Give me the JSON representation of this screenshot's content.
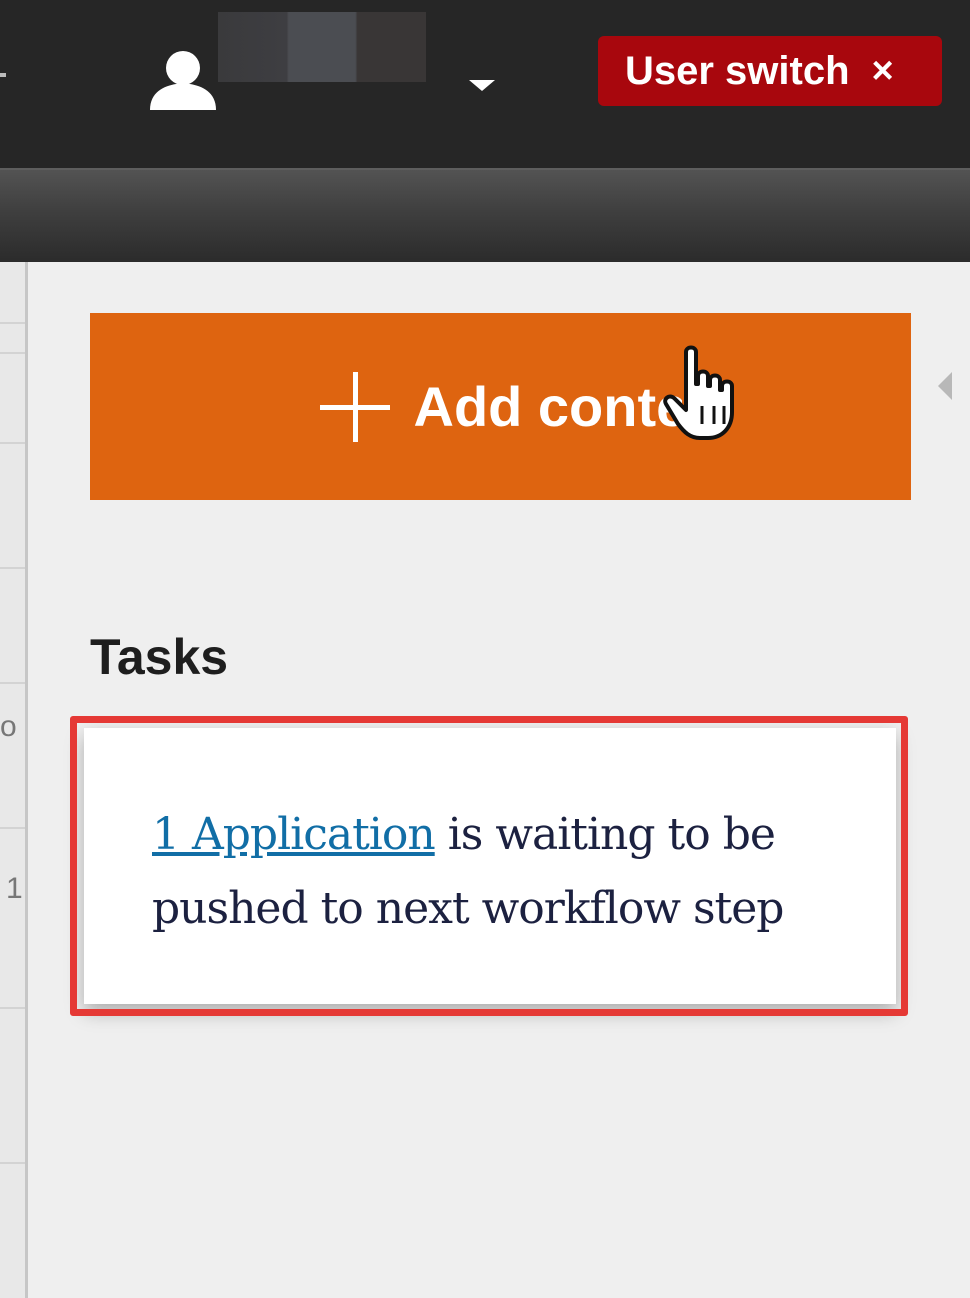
{
  "header": {
    "user_switch_label": "User switch",
    "user_switch_close": "×"
  },
  "main": {
    "add_button_label": "Add content",
    "tasks_title": "Tasks",
    "task": {
      "link_text": "1 Application",
      "text_line1": " is waiting to be",
      "text_line2": "pushed to next workflow step"
    }
  },
  "left_strip": {
    "frag_1": "o",
    "frag_2": "1"
  },
  "colors": {
    "topbar": "#262626",
    "user_switch_bg": "#a8070d",
    "add_button_bg": "#de6410",
    "highlight": "#e53935",
    "link": "#116ea6"
  },
  "icons": {
    "user": "user-icon",
    "dropdown": "caret-down-icon",
    "close": "close-icon",
    "plus": "plus-icon",
    "collapse": "chevron-left-icon",
    "cursor": "hand-pointer-cursor-icon"
  }
}
